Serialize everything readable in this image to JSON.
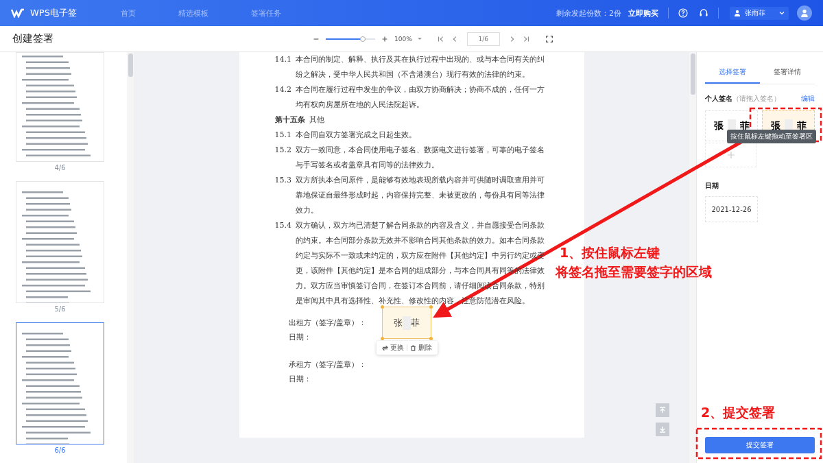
{
  "header": {
    "product": "WPS电子签",
    "nav": [
      {
        "label": "首页",
        "selected": false
      },
      {
        "label": "精选模板",
        "selected": false
      },
      {
        "label": "签署任务",
        "selected": false
      }
    ],
    "quota": "剩余发起份数：2份",
    "buy": "立即购买",
    "user": "张雨菲"
  },
  "toolbar": {
    "title": "创建签署",
    "zoom": {
      "level": 0.75,
      "reading": "100%"
    },
    "page": "1/6"
  },
  "thumbnails": [
    {
      "label": "4/6",
      "selected": false
    },
    {
      "label": "5/6",
      "selected": false
    },
    {
      "label": "6/6",
      "selected": true
    }
  ],
  "document": {
    "clauses": [
      {
        "kind": "item",
        "num": "14.1",
        "text": "本合同的制定、解释、执行及其在执行过程中出现的、或与本合同有关的纠纷之解决，受中华人民共和国（不含港澳台）现行有效的法律的约束。"
      },
      {
        "kind": "item",
        "num": "14.2",
        "text": "本合同在履行过程中发生的争议，由双方协商解决；协商不成的，任何一方均有权向房屋所在地的人民法院起诉。"
      },
      {
        "kind": "heading",
        "num": "第十五条",
        "text": "其他"
      },
      {
        "kind": "item",
        "num": "15.1",
        "text": "本合同自双方签署完成之日起生效。"
      },
      {
        "kind": "item",
        "num": "15.2",
        "text": "双方一致同意，本合同使用电子签名、数据电文进行签署，可靠的电子签名与手写签名或者盖章具有同等的法律效力。"
      },
      {
        "kind": "item",
        "num": "15.3",
        "text": "双方所执本合同原件，是能够有效地表现所载内容并可供随时调取查用并可靠地保证自最终形成时起，内容保持完整、未被更改的，每份具有同等法律效力。"
      },
      {
        "kind": "item",
        "num": "15.4",
        "text": "双方确认，双方均已清楚了解合同条款的内容及含义，并自愿接受合同条款的约束。本合同部分条款无效并不影响合同其他条款的效力。如本合同条款约定与实际不一致或未约定的，双方应在附件【其他约定】中另行约定或变更，该附件【其他约定】是本合同的组成部分，与本合同具有同等的法律效力。双方应当审慎签订合同，在签订本合同前，请仔细阅读合同条款，特别是审阅其中具有选择性、补充性、修改性的内容，注意防范潜在风险。"
      }
    ],
    "signers": [
      {
        "label": "出租方（签字/盖章）：",
        "date_label": "日期："
      },
      {
        "label": "承租方（签字/盖章）：",
        "date_label": "日期："
      }
    ],
    "placed_signature": {
      "first": "张",
      "last": "菲",
      "actions": [
        {
          "kind": "replace",
          "label": "更换"
        },
        {
          "kind": "delete",
          "label": "删除"
        }
      ]
    }
  },
  "panel": {
    "tabs": [
      {
        "label": "选择签署",
        "selected": true
      },
      {
        "label": "签署详情",
        "selected": false
      }
    ],
    "signature_title": "个人签名",
    "signature_hint": "（请拖入签名）",
    "edit": "编辑",
    "signatures": [
      {
        "first": "張",
        "last": "菲",
        "selected": false
      },
      {
        "first": "張",
        "last": "菲",
        "selected": true
      }
    ],
    "tooltip": "按住鼠标左键拖动至签署区",
    "date_title": "日期",
    "date": "2021-12-26",
    "submit": "提交签署"
  },
  "annotations": [
    {
      "text": "1、按住鼠标左键"
    },
    {
      "text": "将签名拖至需要签字的区域"
    },
    {
      "text": "2、提交签署"
    }
  ]
}
